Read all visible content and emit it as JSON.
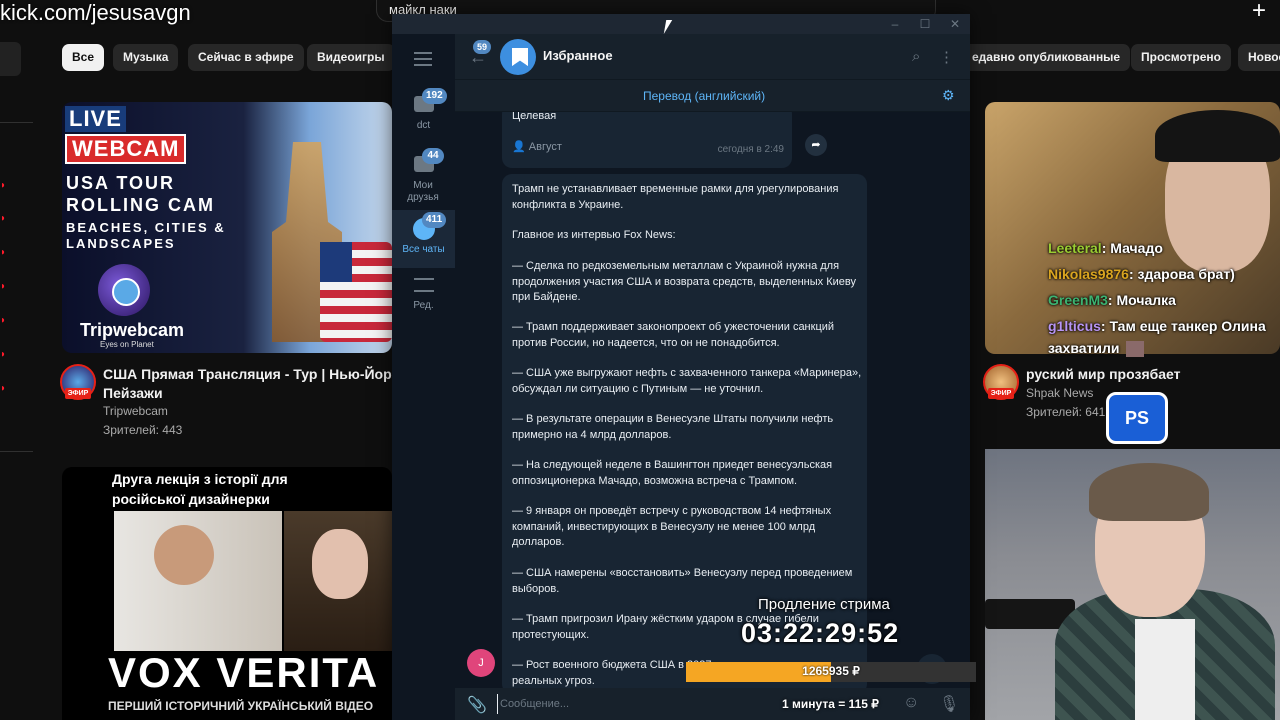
{
  "watermark": "kick.com/jesusavgn",
  "youtube": {
    "search_value": "майкл наки",
    "chips": [
      "Все",
      "Музыка",
      "Сейчас в эфире",
      "Видеоигры",
      "едавно опубликованные",
      "Просмотрено",
      "Новое"
    ],
    "videos": [
      {
        "title_line1": "США Прямая Трансляция - Тур | Нью-Йорк, Го",
        "title_line2": "Пейзажи",
        "channel": "Tripwebcam",
        "viewers": "Зрителей: 443",
        "live_badge": "ЭФИР",
        "thumb_text": {
          "live": "LIVE",
          "webcam": "WEBCAM",
          "line1": "USA TOUR",
          "line2": "ROLLING CAM",
          "line3": "BEACHES, CITIES &",
          "line4": "LANDSCAPES",
          "brand": "Tripwebcam",
          "brand_sub": "Eyes on Planet"
        }
      },
      {
        "title": "руский мир прозябает",
        "channel": "Shpak News",
        "viewers": "Зрителей: 641",
        "live_badge": "ЭФИР"
      },
      {
        "thumb_caption_line1": "Друга лекція з історії для",
        "thumb_caption_line2": "російської дизайнерки",
        "thumb_big": "VOX VERITA",
        "thumb_bottom": "ПЕРШИЙ ІСТОРИЧНИЙ УКРАЇНСЬКИЙ ВІДЕО"
      }
    ]
  },
  "stream_chat": [
    {
      "user": "Leeteral",
      "text": ": Мачадо"
    },
    {
      "user": "Nikolas9876",
      "text": ": здарова брат)"
    },
    {
      "user": "GreenM3",
      "text": ": Мочалка"
    },
    {
      "user": "g1lticus",
      "text": ": Там еще танкер Олина"
    },
    {
      "user": "",
      "text": "захватили"
    }
  ],
  "ps_badge": "PS",
  "telegram": {
    "chat_title": "Избранное",
    "back_badge": "59",
    "translate_label": "Перевод (английский)",
    "folders": [
      {
        "label": "dct",
        "badge": "192"
      },
      {
        "label": "Мои друзья",
        "badge": "44"
      },
      {
        "label": "Все чаты",
        "badge": "411"
      },
      {
        "label": "Ред.",
        "badge": ""
      }
    ],
    "prev_message": {
      "text": "Целевая",
      "author": "Август",
      "time": "сегодня в 2:49"
    },
    "message_paragraphs": [
      "Трамп не устанавливает временные рамки для урегулирования конфликта в Украине.",
      "Главное из интервью Fox News:",
      "— Сделка по редкоземельным металлам с Украиной нужна для продолжения участия США и возврата средств, выделенных Киеву при Байдене.",
      "— Трамп поддерживает законопроект об ужесточении санкций против России, но надеется, что он не понадобится.",
      "— США уже выгружают нефть с захваченного танкера «Маринера», обсуждал ли ситуацию с Путиным — не уточнил.",
      "— В результате операции в Венесуэле Штаты получили нефть примерно на 4 млрд долларов.",
      "— На следующей неделе в Вашингтон приедет венесуэльская оппозиционерка Мачадо, возможна встреча с Трампом.",
      "— 9 января он проведёт встречу с руководством 14 нефтяных компаний, инвестирующих в Венесуэлу не менее 100 млрд долларов.",
      "— США намерены «восстановить» Венесуэлу перед проведением выборов.",
      "— Трамп пригрозил Ирану жёстким ударом в случае гибели протестующих.",
      "— Рост военного бюджета США в 2027 году он связал с наличием реальных угроз."
    ],
    "sender_initial": "J",
    "input_placeholder": "Сообщение..."
  },
  "overlay": {
    "label": "Продление стрима",
    "timer": "03:22:29:52",
    "amount": "1265935 ₽",
    "progress_percent": 50,
    "rate": "1 минута = 115 ₽",
    "accent_color": "#f5a623"
  }
}
